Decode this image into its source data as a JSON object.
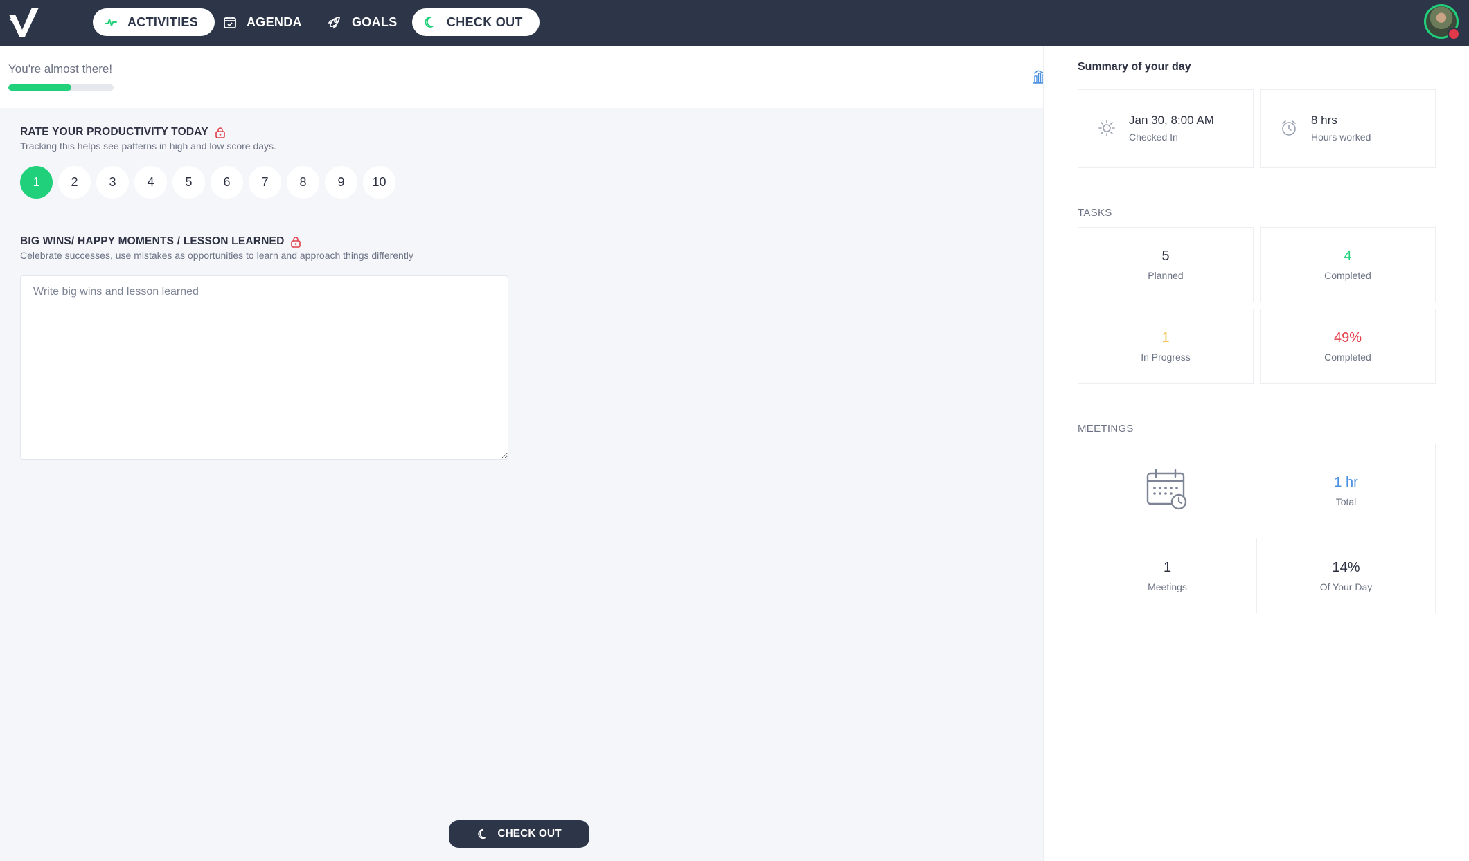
{
  "nav": {
    "tabs": [
      {
        "label": "ACTIVITIES",
        "icon": "activity-pulse-icon"
      },
      {
        "label": "AGENDA",
        "icon": "calendar-check-icon"
      },
      {
        "label": "GOALS",
        "icon": "rocket-icon"
      },
      {
        "label": "CHECK OUT",
        "icon": "moon-icon"
      }
    ]
  },
  "progress": {
    "label": "You're almost there!",
    "value": 0.6
  },
  "productivity": {
    "title": "RATE YOUR PRODUCTIVITY TODAY",
    "subtitle": "Tracking this helps see patterns in high and low score days.",
    "options": [
      "1",
      "2",
      "3",
      "4",
      "5",
      "6",
      "7",
      "8",
      "9",
      "10"
    ],
    "selected": "1"
  },
  "wins": {
    "title": "BIG WINS/ HAPPY MOMENTS / LESSON LEARNED",
    "subtitle": "Celebrate successes, use mistakes as opportunities to learn and approach things differently",
    "placeholder": "Write big wins and lesson learned"
  },
  "checkout_button": "CHECK OUT",
  "summary": {
    "title": "Summary of your day",
    "checked_in": {
      "value": "Jan 30, 8:00 AM",
      "label": "Checked In"
    },
    "hours": {
      "value": "8 hrs",
      "label": "Hours worked"
    },
    "tasks_label": "TASKS",
    "planned": {
      "value": "5",
      "label": "Planned"
    },
    "completed": {
      "value": "4",
      "label": "Completed"
    },
    "in_progress": {
      "value": "1",
      "label": "In Progress"
    },
    "completed_pct": {
      "value": "49%",
      "label": "Completed"
    },
    "meetings_label": "MEETINGS",
    "meeting_total": {
      "value": "1 hr",
      "label": "Total"
    },
    "meeting_count": {
      "value": "1",
      "label": "Meetings"
    },
    "meeting_pct": {
      "value": "14%",
      "label": "Of Your Day"
    }
  },
  "colors": {
    "nav": "#2d3549",
    "accent_green": "#21d07a",
    "warning_yellow": "#f2c14e",
    "danger_red": "#e0404a",
    "info_blue": "#4a90e2"
  }
}
